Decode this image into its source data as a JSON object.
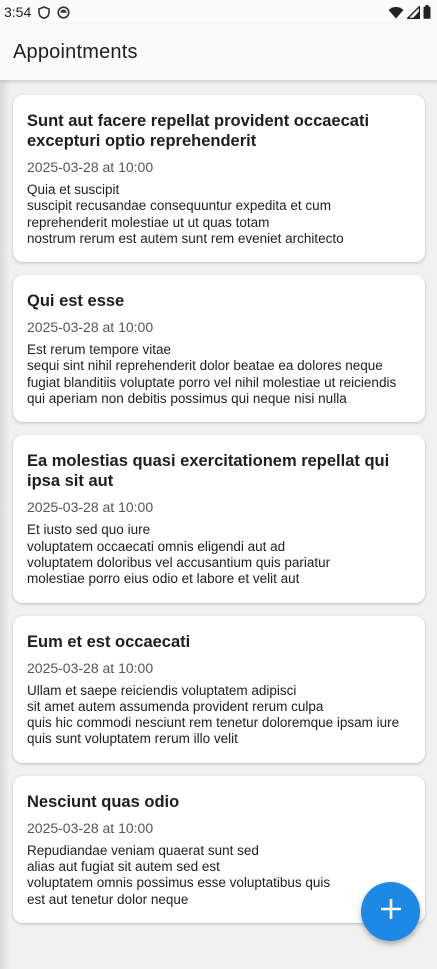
{
  "status_bar": {
    "time": "3:54",
    "left_icons": [
      "shield-icon",
      "privacy-icon"
    ],
    "right_icons": [
      "wifi-icon",
      "cell-signal-icon",
      "battery-icon"
    ]
  },
  "app_bar": {
    "title": "Appointments"
  },
  "appointments": [
    {
      "title": "Sunt aut facere repellat provident occaecati excepturi optio reprehenderit",
      "datetime": "2025-03-28 at 10:00",
      "description": "Quia et suscipit\nsuscipit recusandae consequuntur expedita et cum reprehenderit molestiae ut ut quas totam\nnostrum rerum est autem sunt rem eveniet architecto"
    },
    {
      "title": "Qui est esse",
      "datetime": "2025-03-28 at 10:00",
      "description": "Est rerum tempore vitae\nsequi sint nihil reprehenderit dolor beatae ea dolores neque\nfugiat blanditiis voluptate porro vel nihil molestiae ut reiciendis\nqui aperiam non debitis possimus qui neque nisi nulla"
    },
    {
      "title": "Ea molestias quasi exercitationem repellat qui ipsa sit aut",
      "datetime": "2025-03-28 at 10:00",
      "description": "Et iusto sed quo iure\nvoluptatem occaecati omnis eligendi aut ad\nvoluptatem doloribus vel accusantium quis pariatur\nmolestiae porro eius odio et labore et velit aut"
    },
    {
      "title": "Eum et est occaecati",
      "datetime": "2025-03-28 at 10:00",
      "description": "Ullam et saepe reiciendis voluptatem adipisci\nsit amet autem assumenda provident rerum culpa\nquis hic commodi nesciunt rem tenetur doloremque ipsam iure\nquis sunt voluptatem rerum illo velit"
    },
    {
      "title": "Nesciunt quas odio",
      "datetime": "2025-03-28 at 10:00",
      "description": "Repudiandae veniam quaerat sunt sed\nalias aut fugiat sit autem sed est\nvoluptatem omnis possimus esse voluptatibus quis\nest aut tenetur dolor neque"
    }
  ],
  "fab": {
    "icon": "plus-icon",
    "color": "#1e88e5"
  },
  "colors": {
    "fab": "#1e88e5",
    "app_bar": "#fafafa",
    "background": "#f1f1f1",
    "card": "#ffffff"
  }
}
